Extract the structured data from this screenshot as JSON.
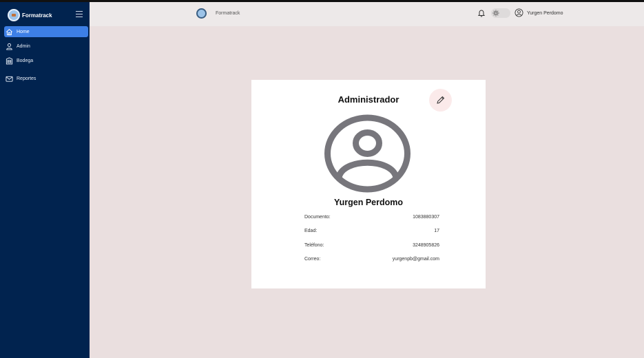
{
  "app": {
    "brand": "Formatrack",
    "header_title": "Formatrack",
    "user_name": "Yurgen Perdomo"
  },
  "sidebar": {
    "items": [
      {
        "label": "Home",
        "icon": "home-icon",
        "active": true
      },
      {
        "label": "Admin",
        "icon": "user-icon"
      },
      {
        "label": "Bodega",
        "icon": "warehouse-icon"
      },
      {
        "label": "Reportes",
        "icon": "mail-icon"
      }
    ]
  },
  "profile": {
    "title": "Administrador",
    "name": "Yurgen Perdomo",
    "fields": [
      {
        "label": "Documento:",
        "value": "1083880307"
      },
      {
        "label": "Edad:",
        "value": "17"
      },
      {
        "label": "Teléfono:",
        "value": "3248905826"
      },
      {
        "label": "Correo:",
        "value": "yurgenpb@gmail.com"
      }
    ]
  },
  "colors": {
    "sidebar": "#01234f",
    "active_item": "#3d7fe6",
    "topbar": "#ede9e9",
    "background": "#eadfdf",
    "avatar": "#77767c",
    "edit_button": "#fbeaea"
  }
}
